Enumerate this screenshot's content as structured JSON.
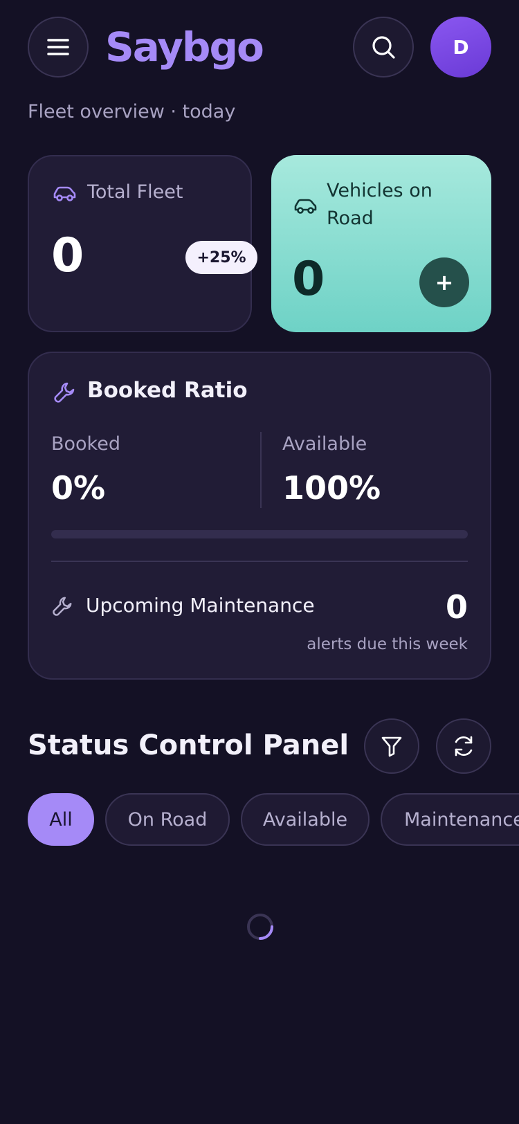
{
  "header": {
    "brand": "Saybgo",
    "avatar_initial": "D",
    "subtitle": "Fleet overview · today",
    "icons": [
      "menu-icon",
      "search-icon"
    ]
  },
  "stats": {
    "total_fleet": {
      "label": "Total Fleet",
      "value": "0",
      "badge": "+25%",
      "icon": "car-icon"
    },
    "vehicles_on_road": {
      "label": "Vehicles on Road",
      "value": "0",
      "action_label": "+",
      "icon": "car-icon"
    }
  },
  "booked_ratio": {
    "title": "Booked Ratio",
    "icon": "wrench-icon",
    "booked_label": "Booked",
    "booked_value": "0%",
    "available_label": "Available",
    "available_value": "100%",
    "booked_fraction": 0,
    "maintenance": {
      "label": "Upcoming Maintenance",
      "count": "0",
      "caption": "alerts due this week",
      "icon": "wrench-icon"
    }
  },
  "status_panel": {
    "title": "Status Control Panel",
    "icons": [
      "filter-icon",
      "refresh-icon"
    ],
    "filters": [
      "All",
      "On Road",
      "Available",
      "Maintenance"
    ],
    "active_filter": "All"
  },
  "colors": {
    "background": "#141125",
    "accent": "#a58af7",
    "card": "#211c36",
    "mint": "#7fd9cd"
  }
}
